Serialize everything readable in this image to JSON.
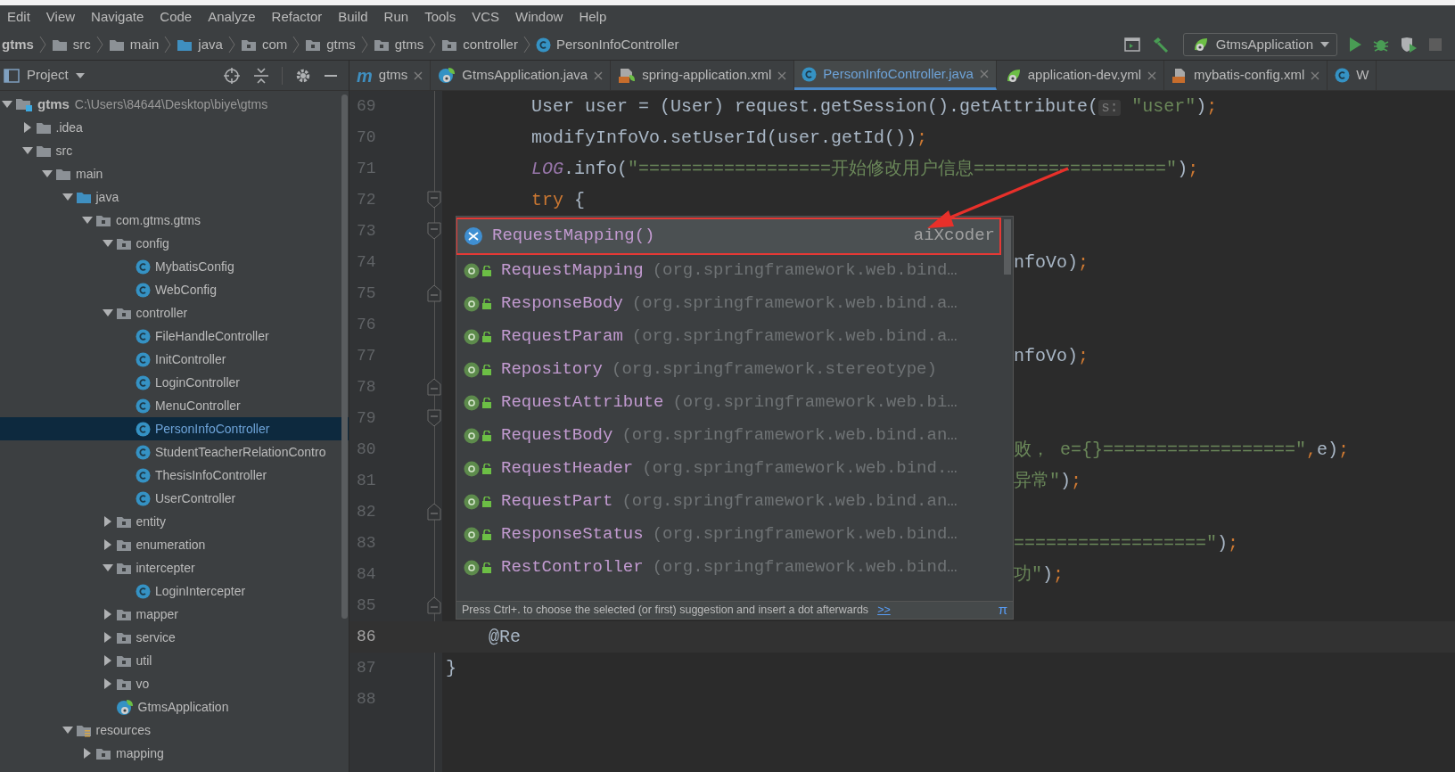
{
  "menu": [
    "Edit",
    "View",
    "Navigate",
    "Code",
    "Analyze",
    "Refactor",
    "Build",
    "Run",
    "Tools",
    "VCS",
    "Window",
    "Help"
  ],
  "breadcrumbs": [
    {
      "label": "gtms",
      "kind": "module"
    },
    {
      "label": "src",
      "kind": "folder"
    },
    {
      "label": "main",
      "kind": "folder"
    },
    {
      "label": "java",
      "kind": "source"
    },
    {
      "label": "com",
      "kind": "package"
    },
    {
      "label": "gtms",
      "kind": "package"
    },
    {
      "label": "gtms",
      "kind": "package"
    },
    {
      "label": "controller",
      "kind": "package"
    },
    {
      "label": "PersonInfoController",
      "kind": "class"
    }
  ],
  "run_config": {
    "label": "GtmsApplication"
  },
  "project_panel": {
    "title": "Project",
    "tree": [
      {
        "label": "gtms",
        "path": "C:\\Users\\84644\\Desktop\\biye\\gtms",
        "kind": "module",
        "expanded": true,
        "selected": false,
        "children": [
          {
            "label": ".idea",
            "kind": "folder",
            "expanded": false,
            "selected": false
          },
          {
            "label": "src",
            "kind": "folder",
            "expanded": true,
            "selected": false,
            "children": [
              {
                "label": "main",
                "kind": "folder",
                "expanded": true,
                "selected": false,
                "children": [
                  {
                    "label": "java",
                    "kind": "source",
                    "expanded": true,
                    "selected": false,
                    "children": [
                      {
                        "label": "com.gtms.gtms",
                        "kind": "package",
                        "expanded": true,
                        "selected": false,
                        "children": [
                          {
                            "label": "config",
                            "kind": "package",
                            "expanded": true,
                            "selected": false,
                            "children": [
                              {
                                "label": "MybatisConfig",
                                "kind": "class",
                                "selected": false
                              },
                              {
                                "label": "WebConfig",
                                "kind": "class",
                                "selected": false
                              }
                            ]
                          },
                          {
                            "label": "controller",
                            "kind": "package",
                            "expanded": true,
                            "selected": false,
                            "children": [
                              {
                                "label": "FileHandleController",
                                "kind": "class",
                                "selected": false
                              },
                              {
                                "label": "InitController",
                                "kind": "class",
                                "selected": false
                              },
                              {
                                "label": "LoginController",
                                "kind": "class",
                                "selected": false
                              },
                              {
                                "label": "MenuController",
                                "kind": "class",
                                "selected": false
                              },
                              {
                                "label": "PersonInfoController",
                                "kind": "class",
                                "selected": true
                              },
                              {
                                "label": "StudentTeacherRelationContro",
                                "kind": "class",
                                "selected": false
                              },
                              {
                                "label": "ThesisInfoController",
                                "kind": "class",
                                "selected": false
                              },
                              {
                                "label": "UserController",
                                "kind": "class",
                                "selected": false
                              }
                            ]
                          },
                          {
                            "label": "entity",
                            "kind": "package",
                            "expanded": false,
                            "selected": false
                          },
                          {
                            "label": "enumeration",
                            "kind": "package",
                            "expanded": false,
                            "selected": false
                          },
                          {
                            "label": "intercepter",
                            "kind": "package",
                            "expanded": true,
                            "selected": false,
                            "children": [
                              {
                                "label": "LoginIntercepter",
                                "kind": "class",
                                "selected": false
                              }
                            ]
                          },
                          {
                            "label": "mapper",
                            "kind": "package",
                            "expanded": false,
                            "selected": false
                          },
                          {
                            "label": "service",
                            "kind": "package",
                            "expanded": false,
                            "selected": false
                          },
                          {
                            "label": "util",
                            "kind": "package",
                            "expanded": false,
                            "selected": false
                          },
                          {
                            "label": "vo",
                            "kind": "package",
                            "expanded": false,
                            "selected": false
                          },
                          {
                            "label": "GtmsApplication",
                            "kind": "spring",
                            "selected": false
                          }
                        ]
                      }
                    ]
                  },
                  {
                    "label": "resources",
                    "kind": "resources",
                    "expanded": true,
                    "selected": false,
                    "children": [
                      {
                        "label": "mapping",
                        "kind": "package",
                        "expanded": false,
                        "selected": false
                      }
                    ]
                  }
                ]
              }
            ]
          }
        ]
      }
    ]
  },
  "tabs": [
    {
      "label": "gtms",
      "kind": "maven",
      "glyph": "m",
      "selected": false
    },
    {
      "label": "GtmsApplication.java",
      "kind": "spring",
      "selected": false
    },
    {
      "label": "spring-application.xml",
      "kind": "springxml",
      "selected": false
    },
    {
      "label": "PersonInfoController.java",
      "kind": "class",
      "selected": true
    },
    {
      "label": "application-dev.yml",
      "kind": "yml",
      "selected": false
    },
    {
      "label": "mybatis-config.xml",
      "kind": "xml",
      "selected": false
    },
    {
      "label": "W",
      "kind": "class",
      "selected": false
    }
  ],
  "editor": {
    "lines": [
      {
        "number": "69",
        "current": false,
        "segments": [
          {
            "text": "        User user = (User) request.getSession().getAttribute(",
            "kind": "plain"
          },
          {
            "text": "s:",
            "kind": "hint"
          },
          {
            "text": "\"user\"",
            "kind": "string"
          },
          {
            "text": ")",
            "kind": "plain"
          },
          {
            "text": ";",
            "kind": "punct"
          }
        ]
      },
      {
        "number": "70",
        "current": false,
        "segments": [
          {
            "text": "        modifyInfoVo.setUserId(user.getId())",
            "kind": "plain"
          },
          {
            "text": ";",
            "kind": "punct"
          }
        ]
      },
      {
        "number": "71",
        "current": false,
        "segments": [
          {
            "text": "        LOG",
            "kind": "field"
          },
          {
            "text": ".info(",
            "kind": "plain"
          },
          {
            "text": "\"==================开始修改用户信息==================\"",
            "kind": "string"
          },
          {
            "text": ")",
            "kind": "plain"
          },
          {
            "text": ";",
            "kind": "punct"
          }
        ]
      },
      {
        "number": "72",
        "current": false,
        "kind": "opener",
        "segments": [
          {
            "text": "        try",
            "kind": "keyword"
          },
          {
            "text": " {",
            "kind": "plain"
          }
        ]
      },
      {
        "number": "73",
        "current": false,
        "kind": "opener"
      },
      {
        "number": "74",
        "current": false,
        "under_popup": true,
        "segments": [
          {
            "text": "nfoVo)",
            "kind": "plain"
          },
          {
            "text": ";",
            "kind": "punct"
          }
        ]
      },
      {
        "number": "75",
        "current": false,
        "kind": "closer"
      },
      {
        "number": "76",
        "current": false
      },
      {
        "number": "77",
        "current": false,
        "under_popup": true,
        "segments": [
          {
            "text": "nfoVo)",
            "kind": "plain"
          },
          {
            "text": ";",
            "kind": "punct"
          }
        ]
      },
      {
        "number": "78",
        "current": false,
        "kind": "closer"
      },
      {
        "number": "79",
        "current": false,
        "kind": "opener"
      },
      {
        "number": "80",
        "current": false,
        "under_popup": true,
        "segments": [
          {
            "text": "败， e={}==================\"",
            "kind": "string"
          },
          {
            "text": ",",
            "kind": "punct"
          },
          {
            "text": "e)",
            "kind": "plain"
          },
          {
            "text": ";",
            "kind": "punct"
          }
        ]
      },
      {
        "number": "81",
        "current": false,
        "under_popup": true,
        "segments": [
          {
            "text": "异常\"",
            "kind": "string"
          },
          {
            "text": ")",
            "kind": "plain"
          },
          {
            "text": ";",
            "kind": "punct"
          }
        ]
      },
      {
        "number": "82",
        "current": false,
        "kind": "closer"
      },
      {
        "number": "83",
        "current": false,
        "under_popup": true,
        "segments": [
          {
            "text": "==================\"",
            "kind": "string"
          },
          {
            "text": ")",
            "kind": "plain"
          },
          {
            "text": ";",
            "kind": "punct"
          }
        ]
      },
      {
        "number": "84",
        "current": false,
        "under_popup": true,
        "segments": [
          {
            "text": "功\"",
            "kind": "string"
          },
          {
            "text": ")",
            "kind": "plain"
          },
          {
            "text": ";",
            "kind": "punct"
          }
        ]
      },
      {
        "number": "85",
        "current": false,
        "kind": "closer"
      },
      {
        "number": "86",
        "current": true,
        "segments": [
          {
            "text": "    @Re",
            "kind": "plain"
          }
        ]
      },
      {
        "number": "87",
        "current": false,
        "segments": [
          {
            "text": "}",
            "kind": "plain"
          }
        ]
      },
      {
        "number": "88",
        "current": false
      }
    ]
  },
  "completion": {
    "items": [
      {
        "name": "RequestMapping()",
        "detail": "aiXcoder",
        "kind": "aixcoder",
        "selected": true
      },
      {
        "name": "RequestMapping",
        "detail": "(org.springframework.web.bind…",
        "kind": "annotation",
        "selected": false
      },
      {
        "name": "ResponseBody",
        "detail": "(org.springframework.web.bind.a…",
        "kind": "annotation",
        "selected": false
      },
      {
        "name": "RequestParam",
        "detail": "(org.springframework.web.bind.a…",
        "kind": "annotation",
        "selected": false
      },
      {
        "name": "Repository",
        "detail": "(org.springframework.stereotype)",
        "kind": "annotation",
        "selected": false
      },
      {
        "name": "RequestAttribute",
        "detail": "(org.springframework.web.bi…",
        "kind": "annotation",
        "selected": false
      },
      {
        "name": "RequestBody",
        "detail": "(org.springframework.web.bind.an…",
        "kind": "annotation",
        "selected": false
      },
      {
        "name": "RequestHeader",
        "detail": "(org.springframework.web.bind.…",
        "kind": "annotation",
        "selected": false
      },
      {
        "name": "RequestPart",
        "detail": "(org.springframework.web.bind.an…",
        "kind": "annotation",
        "selected": false
      },
      {
        "name": "ResponseStatus",
        "detail": "(org.springframework.web.bind…",
        "kind": "annotation",
        "selected": false
      },
      {
        "name": "RestController",
        "detail": "(org.springframework.web.bind…",
        "kind": "annotation",
        "selected": false
      }
    ],
    "footer": {
      "text": "Press Ctrl+. to choose the selected (or first) suggestion and insert a dot afterwards",
      "link": ">>",
      "symbol": "π"
    }
  }
}
